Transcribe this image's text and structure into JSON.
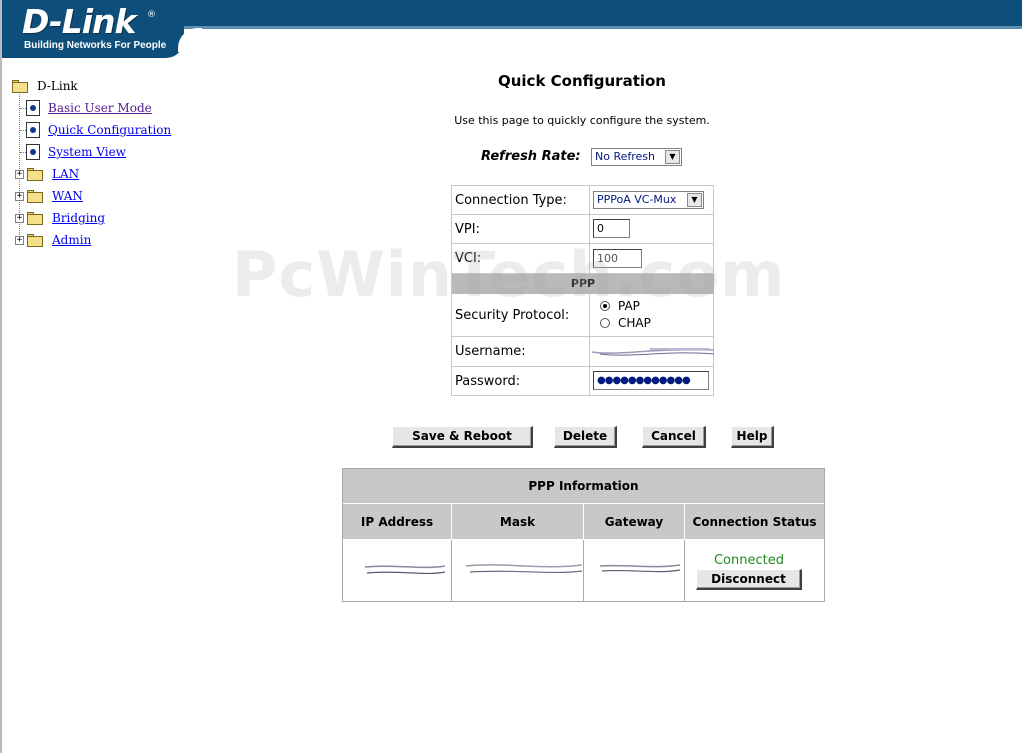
{
  "brand": {
    "logo_text": "D-Link",
    "tagline": "Building Networks For People"
  },
  "sidebar": {
    "root_label": "D-Link",
    "items": [
      {
        "label": "Basic User Mode",
        "icon": "page-icon"
      },
      {
        "label": "Quick Configuration",
        "icon": "page-icon"
      },
      {
        "label": "System View",
        "icon": "page-icon"
      },
      {
        "label": "LAN",
        "icon": "folder-icon"
      },
      {
        "label": "WAN",
        "icon": "folder-icon"
      },
      {
        "label": "Bridging",
        "icon": "folder-icon"
      },
      {
        "label": "Admin",
        "icon": "folder-icon"
      }
    ]
  },
  "page": {
    "title": "Quick Configuration",
    "description": "Use this page to quickly configure the system."
  },
  "refresh": {
    "label": "Refresh Rate:",
    "value": "No Refresh"
  },
  "config": {
    "connection_type_label": "Connection Type:",
    "connection_type_value": "PPPoA VC-Mux",
    "vpi_label": "VPI:",
    "vpi_value": "0",
    "vci_label": "VCI:",
    "vci_value": "100",
    "ppp_section": "PPP",
    "security_label": "Security Protocol:",
    "security_options": [
      "PAP",
      "CHAP"
    ],
    "security_selected": "PAP",
    "username_label": "Username:",
    "password_label": "Password:",
    "password_mask": "●●●●●●●●●●●●"
  },
  "buttons": {
    "save_reboot": "Save & Reboot",
    "delete": "Delete",
    "cancel": "Cancel",
    "help": "Help"
  },
  "ppp_info": {
    "title": "PPP Information",
    "columns": [
      "IP Address",
      "Mask",
      "Gateway",
      "Connection Status"
    ],
    "status": "Connected",
    "disconnect_label": "Disconnect"
  },
  "watermark": "PcWinTech.com"
}
